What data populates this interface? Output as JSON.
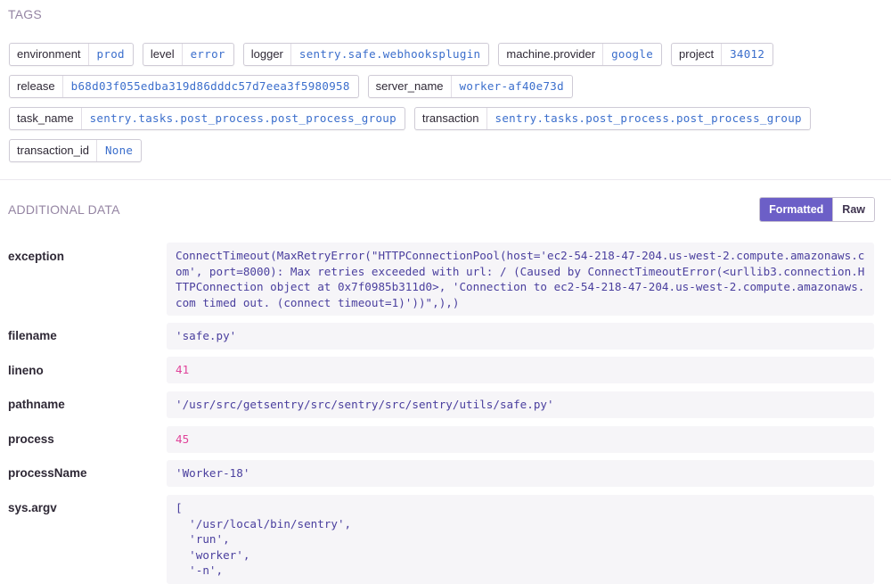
{
  "tags_section": {
    "title": "TAGS",
    "rows": [
      [
        {
          "key": "environment",
          "value": "prod"
        },
        {
          "key": "level",
          "value": "error"
        },
        {
          "key": "logger",
          "value": "sentry.safe.webhooksplugin"
        },
        {
          "key": "machine.provider",
          "value": "google"
        },
        {
          "key": "project",
          "value": "34012"
        }
      ],
      [
        {
          "key": "release",
          "value": "b68d03f055edba319d86dddc57d7eea3f5980958"
        },
        {
          "key": "server_name",
          "value": "worker-af40e73d"
        }
      ],
      [
        {
          "key": "task_name",
          "value": "sentry.tasks.post_process.post_process_group"
        },
        {
          "key": "transaction",
          "value": "sentry.tasks.post_process.post_process_group"
        }
      ],
      [
        {
          "key": "transaction_id",
          "value": "None"
        }
      ]
    ]
  },
  "additional_data": {
    "title": "ADDITIONAL DATA",
    "toggle": {
      "formatted_label": "Formatted",
      "raw_label": "Raw",
      "selected": "Formatted"
    },
    "accent_color": "#6c5fc7",
    "entries": [
      {
        "key": "exception",
        "value": "ConnectTimeout(MaxRetryError(\"HTTPConnectionPool(host='ec2-54-218-47-204.us-west-2.compute.amazonaws.com', port=8000): Max retries exceeded with url: / (Caused by ConnectTimeoutError(<urllib3.connection.HTTPConnection object at 0x7f0985b311d0>, 'Connection to ec2-54-218-47-204.us-west-2.compute.amazonaws.com timed out. (connect timeout=1)'))\",),)",
        "type": "str"
      },
      {
        "key": "filename",
        "value": "'safe.py'",
        "type": "str"
      },
      {
        "key": "lineno",
        "value": "41",
        "type": "num"
      },
      {
        "key": "pathname",
        "value": "'/usr/src/getsentry/src/sentry/src/sentry/utils/safe.py'",
        "type": "str"
      },
      {
        "key": "process",
        "value": "45",
        "type": "num"
      },
      {
        "key": "processName",
        "value": "'Worker-18'",
        "type": "str"
      },
      {
        "key": "sys.argv",
        "value": "[\n  '/usr/local/bin/sentry',\n  'run',\n  'worker',\n  '-n',",
        "type": "str"
      }
    ]
  }
}
